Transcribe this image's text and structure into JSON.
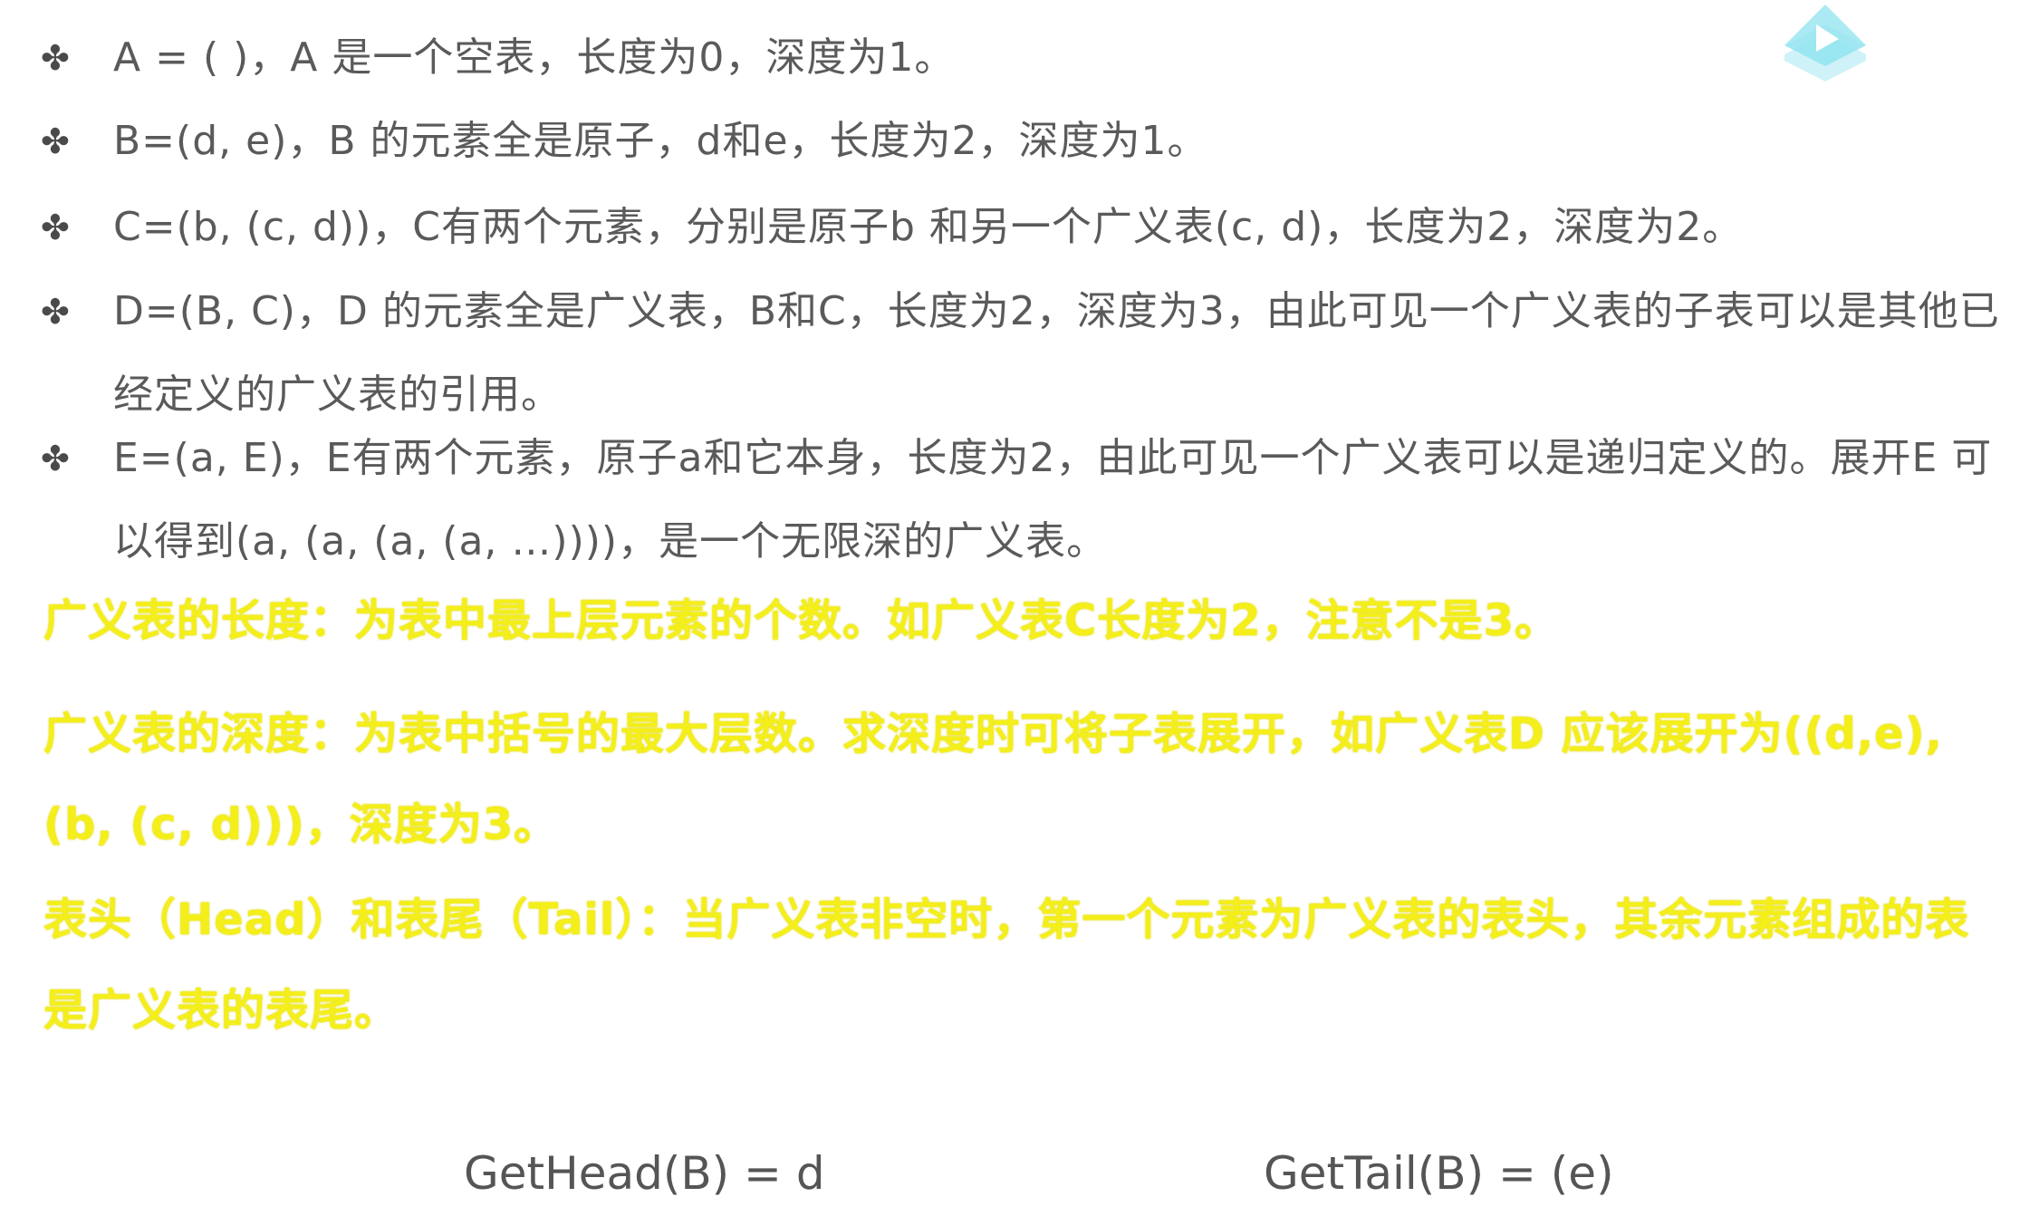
{
  "bullets": [
    {
      "icon": "clover-bullet-icon",
      "text": "A = ( )，A 是一个空表，长度为0，深度为1。"
    },
    {
      "icon": "clover-bullet-icon",
      "text": "B=(d, e)，B 的元素全是原子，d和e，长度为2，深度为1。"
    },
    {
      "icon": "clover-bullet-icon",
      "text": "C=(b, (c, d))，C有两个元素，分别是原子b 和另一个广义表(c, d)，长度为2，深度为2。"
    },
    {
      "icon": "clover-bullet-icon",
      "text": "D=(B, C)，D 的元素全是广义表，B和C，长度为2，深度为3，由此可见一个广义表的子表可以是其他已经定义的广义表的引用。"
    },
    {
      "icon": "clover-bullet-icon",
      "text": "E=(a, E)，E有两个元素，原子a和它本身，长度为2，由此可见一个广义表可以是递归定义的。展开E 可以得到(a, (a, (a, (a, …))))，是一个无限深的广义表。"
    }
  ],
  "highlights": {
    "length_def": "广义表的长度：为表中最上层元素的个数。如广义表C长度为2，注意不是3。",
    "depth_def": "广义表的深度：为表中括号的最大层数。求深度时可将子表展开，如广义表D 应该展开为((d,e), (b, (c, d)))，深度为3。",
    "head_tail_def": "表头（Head）和表尾（Tail）：当广义表非空时，第一个元素为广义表的表头，其余元素组成的表是广义表的表尾。"
  },
  "formulas": {
    "get_head": "GetHead(B) = d",
    "get_tail": "GetTail(B) = (e)"
  },
  "colors": {
    "body_text": "#5a5a5a",
    "highlight_text": "#f4ee1a",
    "logo": "#8fe3ef"
  },
  "logo_icon": "play-logo-icon"
}
